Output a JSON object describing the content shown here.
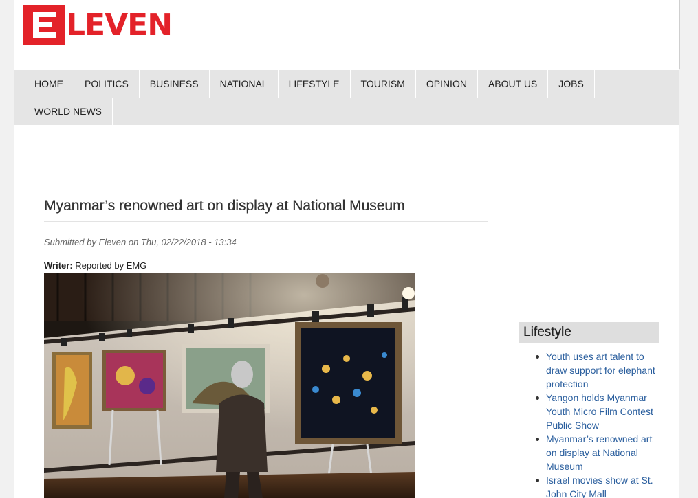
{
  "logo": {
    "text": "LEVEN",
    "brand_color": "#e32229",
    "icon": "eleven-e-logo-icon"
  },
  "nav": {
    "row1": [
      "HOME",
      "POLITICS",
      "BUSINESS",
      "NATIONAL",
      "LIFESTYLE",
      "TOURISM",
      "OPINION",
      "ABOUT US",
      "JOBS"
    ],
    "row2": [
      "WORLD NEWS"
    ]
  },
  "article": {
    "title": "Myanmar’s renowned art on display at National Museum",
    "submitted": "Submitted by Eleven on Thu, 02/22/2018 - 13:34",
    "writer_label": "Writer:",
    "writer_value": " Reported by EMG"
  },
  "sidebar": {
    "title": "Lifestyle",
    "items": [
      "Youth uses art talent to draw support for elephant protection",
      "Yangon holds Myanmar Youth Micro Film Contest Public Show",
      "Myanmar’s renowned art on display at National Museum",
      "Israel movies show at St. John City Mall"
    ],
    "link_color": "#2b5f9e"
  }
}
